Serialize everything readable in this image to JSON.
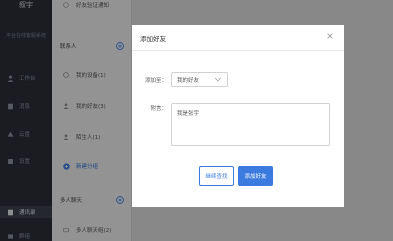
{
  "nav": {
    "title": "叙宇",
    "sub": "平台在线客服系统",
    "items": [
      {
        "label": "工作台",
        "icon": "person-icon"
      },
      {
        "label": "消息",
        "icon": "document-icon"
      },
      {
        "label": "云盘",
        "icon": "cloud-icon"
      },
      {
        "label": "设置",
        "icon": "gear-icon"
      },
      {
        "label": "通讯录",
        "icon": "contacts-icon",
        "active": true
      },
      {
        "label": "群组",
        "icon": "group-icon"
      }
    ]
  },
  "contacts": {
    "top_item": "好友验证通知",
    "section_contacts": "联系人",
    "my_devices": "我的设备(1)",
    "my_friends": "我的好友(3)",
    "strangers": "陌生人(1)",
    "new_group": "新建分组",
    "section_group_chat": "多人聊天",
    "group_chat_item": "多人聊天组(2)"
  },
  "modal": {
    "title": "添加好友",
    "group_label": "添加至：",
    "group_value": "我的好友",
    "note_label": "附言：",
    "note_value": "我是张宇",
    "cancel_label": "继续查找",
    "confirm_label": "添加好友"
  },
  "colors": {
    "accent": "#3b7be0",
    "nav_bg": "#2a2e38"
  }
}
